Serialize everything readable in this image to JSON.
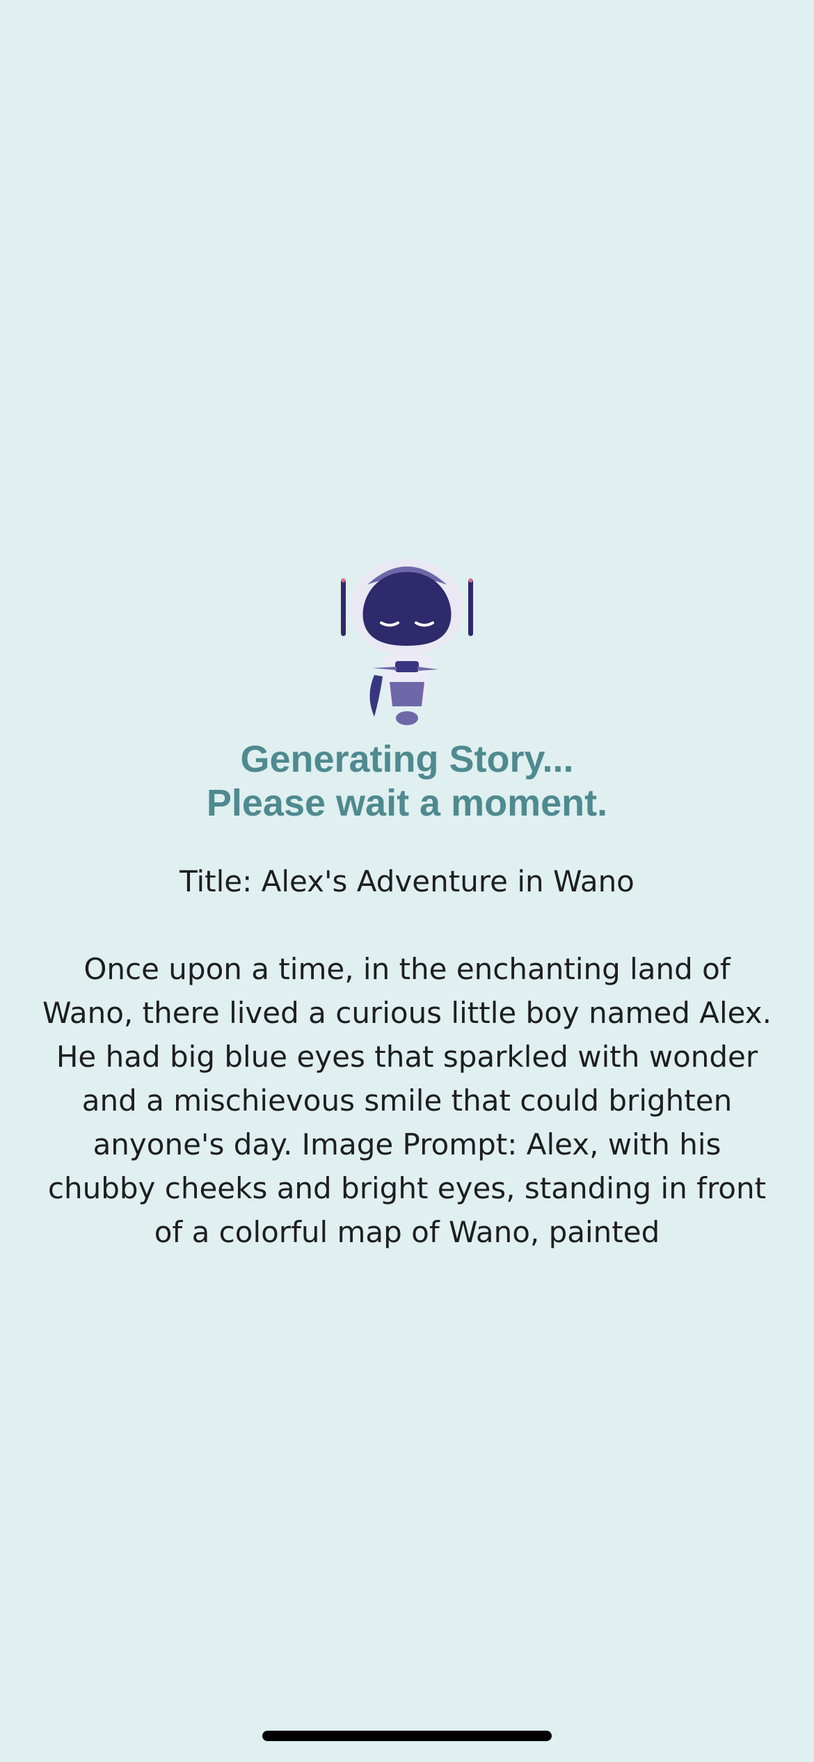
{
  "loading": {
    "heading_line1": "Generating Story...",
    "heading_line2": "Please wait a moment."
  },
  "story": {
    "title_line": "Title: Alex's Adventure in Wano",
    "body": "Once upon a time, in the enchanting land of Wano, there lived a curious little boy named Alex. He had big blue eyes that sparkled with wonder and a mischievous smile that could brighten anyone's day. Image Prompt: Alex, with his chubby cheeks and bright eyes, standing in front of a colorful map of Wano, painted"
  },
  "icons": {
    "mascot": "robot-mascot-icon"
  },
  "colors": {
    "background": "#e0eff0",
    "heading": "#4e8a8f",
    "text": "#1e1e1e",
    "robot_face": "#2e2a6b",
    "robot_accent": "#6e68a8"
  }
}
